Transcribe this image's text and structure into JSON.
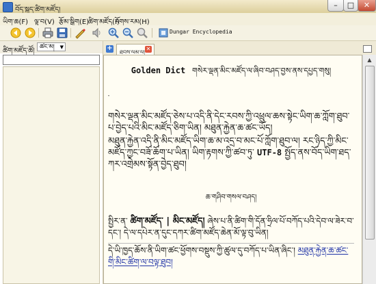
{
  "window": {
    "title": "བོད་སྐད་ཚིག་མཛོད།",
    "minimize": "–",
    "maximize": "□",
    "close": "✕"
  },
  "menu": [
    {
      "label": "ཡིག་ཆ(F)"
    },
    {
      "label": "ལྟ་བ(V)"
    },
    {
      "label": "རྩོམ་སྒྲིག(E)"
    },
    {
      "label": "ཚིག་མཛོད(I)"
    },
    {
      "label": "རོགས་རམ(H)"
    }
  ],
  "toolbar": {
    "dictionary_label": "Dungar Encyclopedia"
  },
  "left_panel": {
    "group_label": "ཚིག་མཛོད་ཚོ།",
    "group_value": "ཚང་མ།",
    "search_value": ""
  },
  "tab": {
    "label": "ཐབས་ལམ་ལ།",
    "close": "✕"
  },
  "article": {
    "title_latin": "Golden Dict",
    "title_tibetan": "གསེར་ལྡན་མིང་མཛོད་ལ་ཞིབ་བཤད་བྱས་ནས་དཔྱད་གསུ།",
    "dot": "་",
    "para1": "གསེར་ལྡན་མིང་མཛོད་ཅེས་པ་འདི་ནི་དེང་རབས་ཀྱི་འཕྲུལ་ཆས་སྟེང་ཡིག་ཆ་ཀློག་ཐུབ་པ་བྱེད་པའི་མིང་མཛོད་ཅིག་ཡིན། མཐུན་རྐྱེན་ཆ་ཚང་ཡོད།",
    "para2": "མཐུན་རྐྱེན་འདི་ནི་མིང་མཛོད་ཡིག་ཆ་མ་འདྲ་བ་མང་པོ་ཀློག་ཐུབ་ལ། རང་ཉིད་ཀྱི་མིང་མཛོད་ཀྱང་བཟོ་ཆོག་པ་ཡིན། ཡིག་རྟགས་ཀྱི་ཚབ་ཏུ་",
    "utf_label": "UTF-8",
    "para2_tail": "སྤྱོད་ནས་བོད་ཡིག་ཐད་ཀར་འགྲེམས་སྟོན་བྱེད་ཐུབ།",
    "heading2": "ཆ་གཤིབ་གསལ་བཤད།",
    "para3_prefix": "སྤྱིར་ན་",
    "para3_bold": "ཚིག་མཛོད་ | མིང་མཛོད།",
    "para3_rest": "ཞེས་པ་ནི་ཚིག་གི་དོན་ཧྲིལ་པོ་བཀོད་པའི་དེབ་ལ་ཟེར་བ་དང་། དེ་ལ་དཔེར་ན་དུང་དཀར་ཚིག་མཛོད་ཆེན་མོ་ལྟ་བུ་ཡིན།",
    "para4": "དེ་ཡི་ཁྱད་ཆོས་ནི་ཡིག་ཚང་ཕྱོགས་བསྡུས་ཀྱི་ཚུལ་དུ་བཀོད་པ་ཡིན་ཞིང་། ",
    "para4_link": "མཐུན་རྐྱེན་ཆ་ཚང་གི་མིང་ཚིག་ལ་བལྟ་ཐུབ།"
  }
}
